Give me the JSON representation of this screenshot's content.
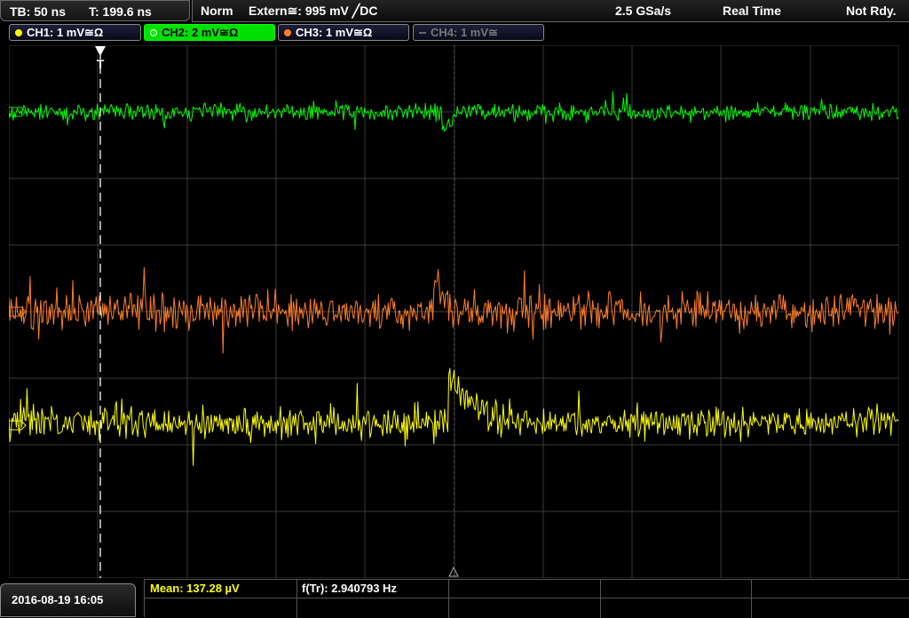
{
  "header": {
    "timebase": "TB: 50 ns",
    "trigger_time": "T: 199.6 ns",
    "mode": "Norm",
    "trigger_source": "Extern≅: 995 mV ╱DC",
    "sample_rate": "2.5 GSa/s",
    "acq_mode": "Real Time",
    "status": "Not Rdy."
  },
  "channels": [
    {
      "label": "CH1: 1 mV≅Ω",
      "color": "#ffff00",
      "active": true
    },
    {
      "label": "CH2: 2 mV≅Ω",
      "color": "#00ff00",
      "active": true,
      "selected": true
    },
    {
      "label": "CH3: 1 mV≅Ω",
      "color": "#ff7f27",
      "active": true
    },
    {
      "label": "CH4: 1 mV≅",
      "color": "#777777",
      "active": false
    }
  ],
  "trigger_marker": "T",
  "footer": {
    "datetime": "2016-08-19 16:05",
    "mean_label": "Mean: 137.28 µV",
    "freq_label": "f(Tr): 2.940793 Hz"
  },
  "colors": {
    "ch1": "#ffff00",
    "ch2": "#00ff00",
    "ch3": "#ff7f27",
    "grid": "#3a3a3a",
    "trigger_line": "#ffffff"
  }
}
